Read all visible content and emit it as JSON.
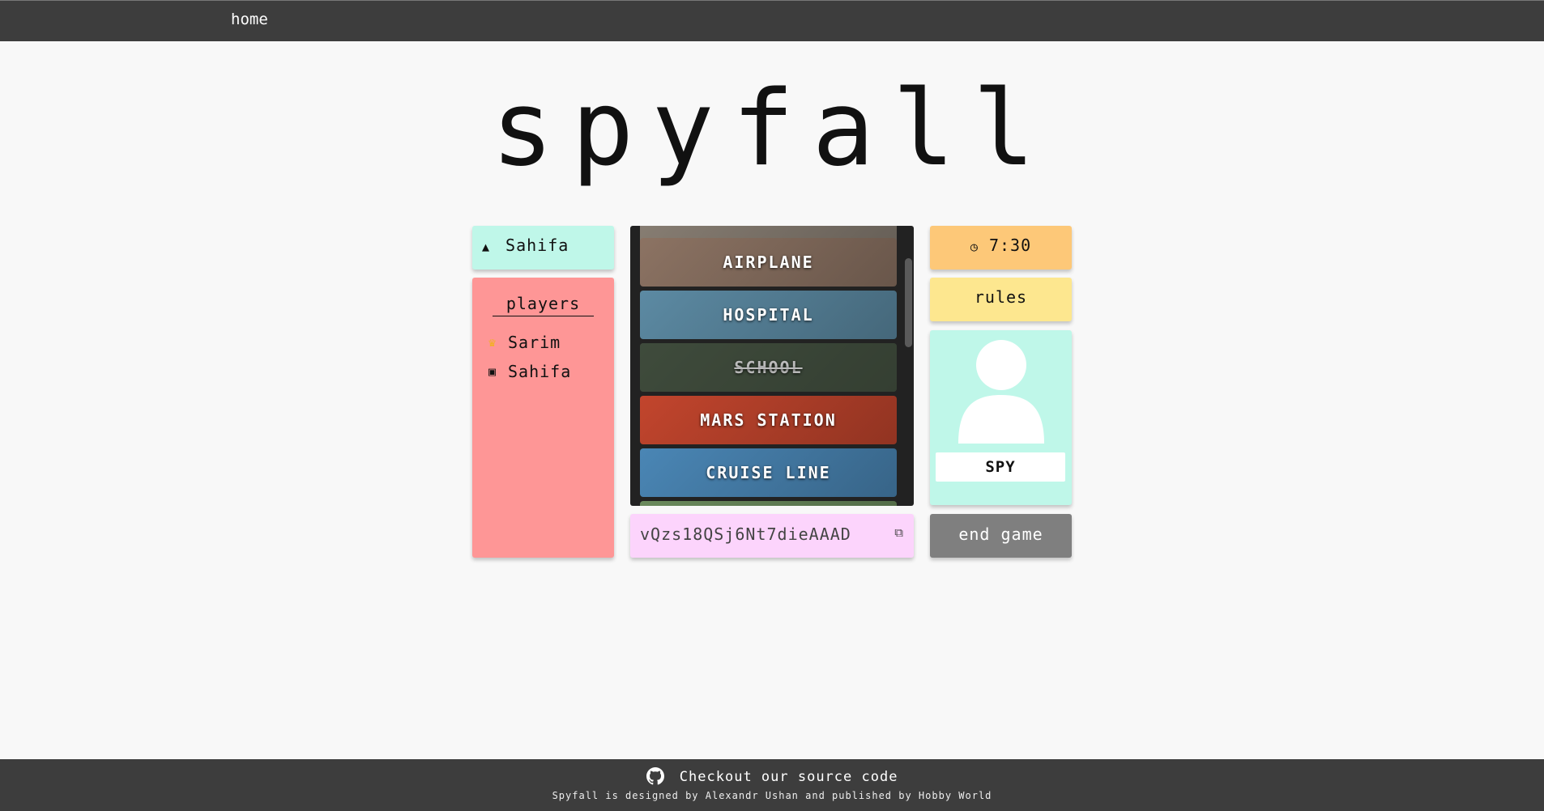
{
  "nav": {
    "home_label": "home"
  },
  "title": "spyfall",
  "current_player": {
    "name": "Sahifa",
    "icon": "poop-icon"
  },
  "players": {
    "heading": "players",
    "list": [
      {
        "name": "Sarim",
        "icon": "crown-icon"
      },
      {
        "name": "Sahifa",
        "icon": "gamepad-icon"
      }
    ]
  },
  "locations": [
    {
      "name": "",
      "crossed": false,
      "color": "#8a8075"
    },
    {
      "name": "AIRPLANE",
      "crossed": false,
      "color": "#8c7363"
    },
    {
      "name": "HOSPITAL",
      "crossed": false,
      "color": "#5c8aa3"
    },
    {
      "name": "SCHOOL",
      "crossed": true,
      "color": "#5b6b54"
    },
    {
      "name": "MARS STATION",
      "crossed": false,
      "color": "#c2452d"
    },
    {
      "name": "CRUISE LINE",
      "crossed": false,
      "color": "#4a86b5"
    },
    {
      "name": "",
      "crossed": false,
      "color": "#6a8a5c"
    }
  ],
  "room_code": "vQzs18QSj6Nt7dieAAAD",
  "timer": "7:30",
  "rules_label": "rules",
  "role": "SPY",
  "end_game_label": "end game",
  "footer": {
    "source_text": "Checkout our source code",
    "credit": "Spyfall is designed by Alexandr Ushan and published by Hobby World"
  },
  "colors": {
    "mint": "#bff7e9",
    "salmon": "#fe9696",
    "pink": "#fcd4fc",
    "orange": "#fdc878",
    "yellow": "#fde78f",
    "gray": "#7f7f7f",
    "dark": "#3d3d3d"
  }
}
